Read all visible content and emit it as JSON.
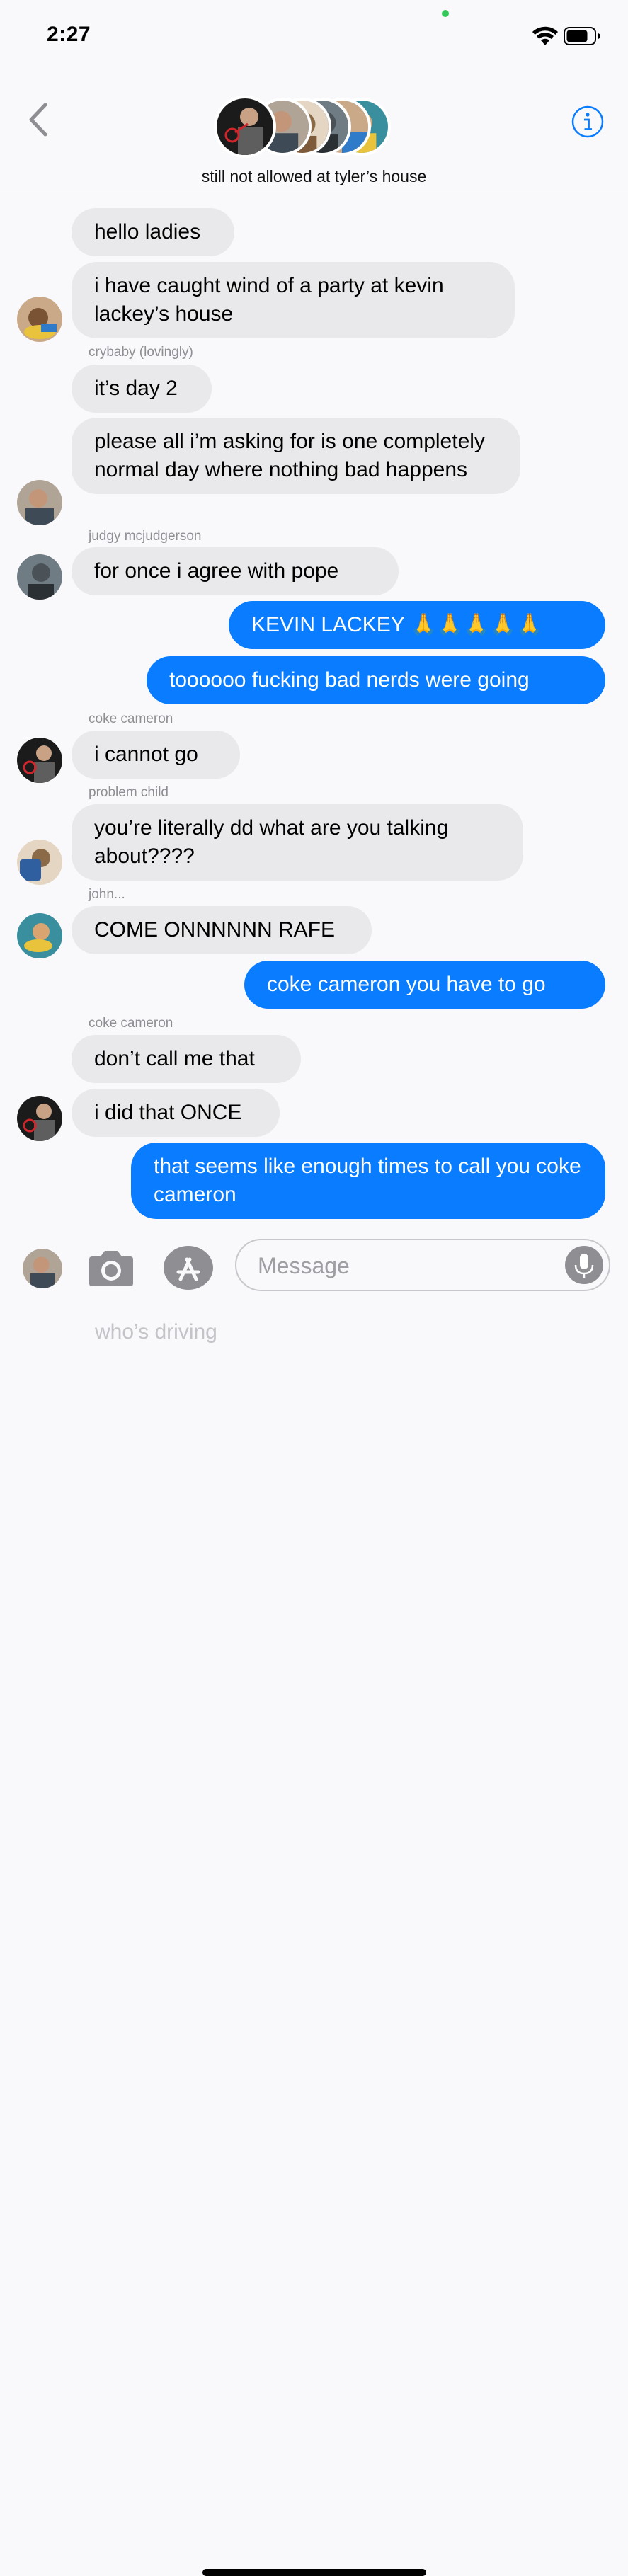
{
  "status_bar": {
    "time": "2:27",
    "icons": [
      "wifi-icon",
      "battery-icon"
    ]
  },
  "header": {
    "group_name": "still not allowed at tyler’s house",
    "icons": [
      "chevron-left-icon",
      "info-icon"
    ],
    "accent_color": "#0a7cff"
  },
  "messages": [
    {
      "direction": "in",
      "text": "hello ladies"
    },
    {
      "direction": "in",
      "text": "i have caught wind of a party at kevin lackey’s house",
      "line2": ""
    },
    {
      "direction": "in",
      "sender": "crybaby (lovingly)",
      "text": "it’s day 2"
    },
    {
      "direction": "in",
      "text": "please all i’m asking for is one completely normal day where nothing bad happens"
    },
    {
      "direction": "in",
      "sender": "judgy mcjudgerson",
      "text": "for once i agree with pope"
    },
    {
      "direction": "out",
      "text": "KEVIN LACKEY 🙏🙏🙏🙏🙏"
    },
    {
      "direction": "out",
      "text": "toooooo fucking bad nerds were going"
    },
    {
      "direction": "in",
      "sender": "coke cameron",
      "text": "i cannot go"
    },
    {
      "direction": "in",
      "sender": "problem child",
      "text": "you’re literally dd what are you talking about????"
    },
    {
      "direction": "in",
      "sender": "john...",
      "text": "COME ONNNNNN RAFE"
    },
    {
      "direction": "out",
      "text": "coke cameron you have to go"
    },
    {
      "direction": "in",
      "sender": "coke cameron",
      "text": "don’t call me that"
    },
    {
      "direction": "in",
      "text": "i did that ONCE"
    },
    {
      "direction": "out",
      "text": "that seems like enough times to call you coke cameron"
    }
  ],
  "composer": {
    "placeholder": "Message",
    "icons": [
      "camera-icon",
      "app-store-icon",
      "microphone-icon"
    ],
    "ghost_text": "who’s driving"
  },
  "colors": {
    "incoming_bubble": "#e9e9eb",
    "outgoing_bubble": "#0a7cff",
    "background": "#f9f9fb"
  }
}
